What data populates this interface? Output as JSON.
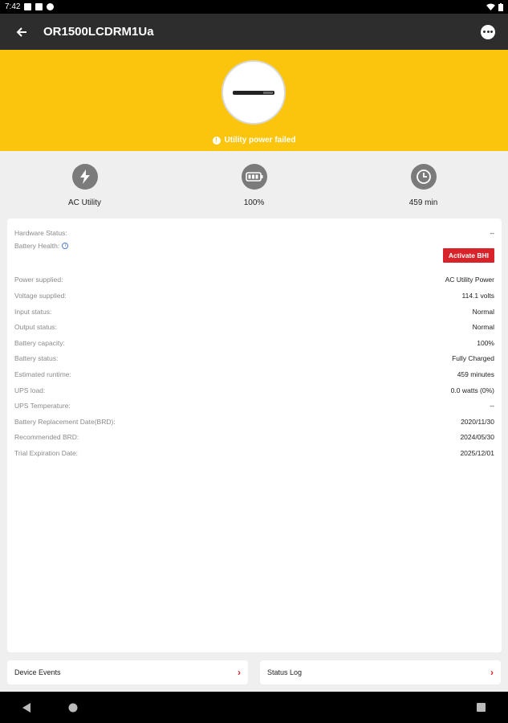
{
  "status_bar": {
    "time": "7:42"
  },
  "app_bar": {
    "title": "OR1500LCDRM1Ua"
  },
  "hero": {
    "alert_text": "Utility power failed",
    "accent_color": "#fbc50e"
  },
  "stats": [
    {
      "icon": "lightning-icon",
      "label": "AC Utility"
    },
    {
      "icon": "battery-icon",
      "label": "100%"
    },
    {
      "icon": "clock-icon",
      "label": "459 min"
    }
  ],
  "details": {
    "hardware_status": {
      "label": "Hardware Status:",
      "value": "--"
    },
    "battery_health": {
      "label": "Battery Health:",
      "button": "Activate BHI"
    },
    "rows": [
      {
        "label": "Power supplied:",
        "value": "AC Utility Power"
      },
      {
        "label": "Voltage supplied:",
        "value": "114.1 volts"
      },
      {
        "label": "Input status:",
        "value": "Normal"
      },
      {
        "label": "Output status:",
        "value": "Normal"
      },
      {
        "label": "Battery capacity:",
        "value": "100%"
      },
      {
        "label": "Battery status:",
        "value": "Fully Charged"
      },
      {
        "label": "Estimated runtime:",
        "value": "459 minutes"
      },
      {
        "label": "UPS load:",
        "value": "0.0 watts (0%)"
      },
      {
        "label": "UPS Temperature:",
        "value": "--"
      },
      {
        "label": "Battery Replacement Date(BRD):",
        "value": "2020/11/30"
      },
      {
        "label": "Recommended BRD:",
        "value": "2024/05/30"
      },
      {
        "label": "Trial Expiration Date:",
        "value": "2025/12/01"
      }
    ]
  },
  "bottom_links": {
    "device_events": "Device Events",
    "status_log": "Status Log"
  },
  "colors": {
    "button_red": "#d8232a",
    "appbar": "#2d2d2d"
  }
}
